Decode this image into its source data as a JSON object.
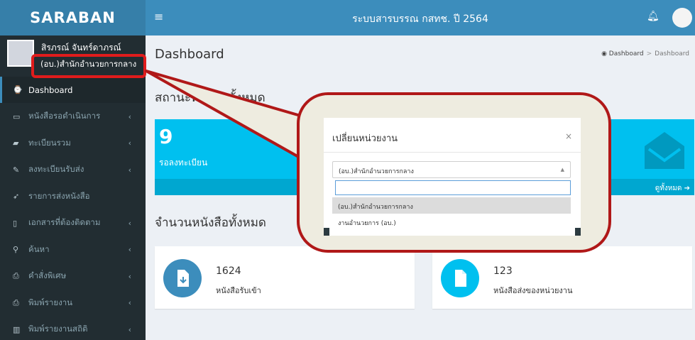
{
  "sidebar": {
    "logo": "SARABAN",
    "user_name": "สิรภรณ์ จันทร์ดาภรณ์",
    "user_unit": "(อบ.)สำนักอำนวยการกลาง",
    "items": [
      {
        "label": "Dashboard",
        "icon": "dashboard-icon",
        "glyph": "⌚"
      },
      {
        "label": "หนังสือรอดำเนินการ",
        "icon": "inbox-icon",
        "glyph": "▭"
      },
      {
        "label": "ทะเบียนรวม",
        "icon": "book-icon",
        "glyph": "▰"
      },
      {
        "label": "ลงทะเบียนรับส่ง",
        "icon": "edit-icon",
        "glyph": "✎"
      },
      {
        "label": "รายการส่งหนังสือ",
        "icon": "send-icon",
        "glyph": "➶"
      },
      {
        "label": "เอกสารที่ต้องติดตาม",
        "icon": "bookmark-icon",
        "glyph": "▯"
      },
      {
        "label": "ค้นหา",
        "icon": "search-icon",
        "glyph": "⚲"
      },
      {
        "label": "คำสั่งพิเศษ",
        "icon": "print-icon",
        "glyph": "⎙"
      },
      {
        "label": "พิมพ์รายงาน",
        "icon": "print-icon",
        "glyph": "⎙"
      },
      {
        "label": "พิมพ์รายงานสถิติ",
        "icon": "bar-chart-icon",
        "glyph": "▥"
      }
    ]
  },
  "topbar": {
    "title": "ระบบสารบรรณ กสทช. ปี 2564"
  },
  "page": {
    "title": "Dashboard",
    "breadcrumb_home": "Dashboard",
    "breadcrumb_current": "Dashboard",
    "section_status": "สถานะหนังสือทั้งหมด",
    "section_count": "จำนวนหนังสือทั้งหมด"
  },
  "stat_pending": {
    "count": "9",
    "label": "รอลงทะเบียน",
    "more": "ดูทั้งหมด ➔"
  },
  "cards": [
    {
      "number": "1624",
      "label": "หนังสือรับเข้า",
      "color": "#3c8dbc"
    },
    {
      "number": "123",
      "label": "หนังสือส่งของหน่วยงาน",
      "color": "#00c0ef"
    }
  ],
  "modal": {
    "title": "เปลี่ยนหน่วยงาน",
    "close": "×",
    "selected": "(อบ.)สำนักอำนวยการกลาง",
    "search_value": "",
    "options": [
      "(อบ.)สำนักอำนวยการกลาง",
      "งานอำนวยการ (อบ.)"
    ]
  },
  "colors": {
    "sidebar_bg": "#222d32",
    "topbar_bg": "#3c8dbc",
    "stat_bg": "#00c0ef",
    "callout_border": "#b01818",
    "callout_fill": "#eeece0"
  }
}
